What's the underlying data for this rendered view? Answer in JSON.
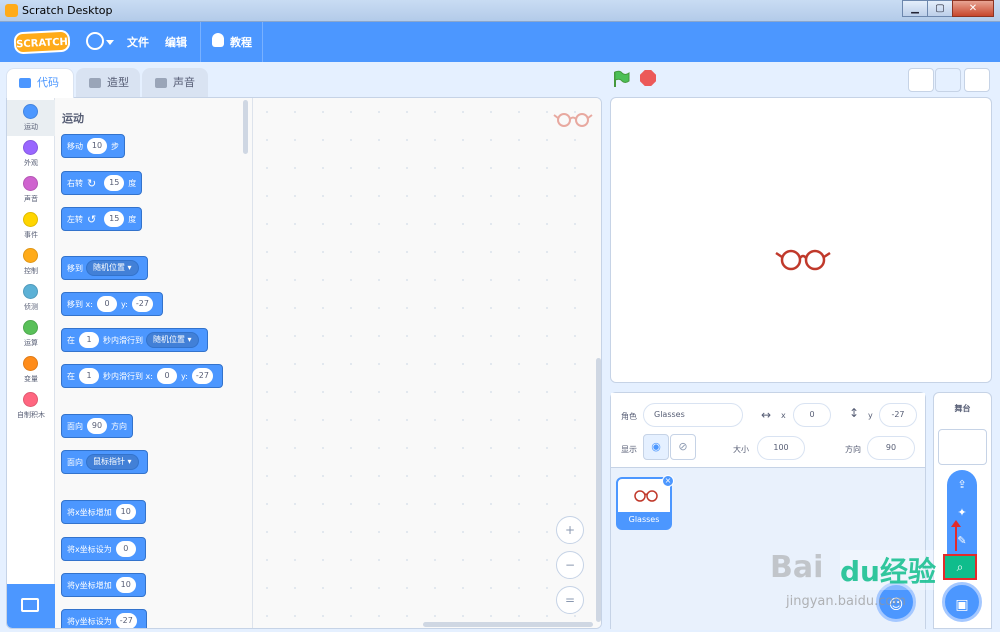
{
  "window": {
    "title": "Scratch Desktop"
  },
  "menubar": {
    "logo": "SCRATCH",
    "file": "文件",
    "edit": "编辑",
    "tutorials": "教程"
  },
  "tabs": [
    {
      "label": "代码"
    },
    {
      "label": "造型"
    },
    {
      "label": "声音"
    }
  ],
  "categories": [
    {
      "label": "运动",
      "color": "#4c97ff"
    },
    {
      "label": "外观",
      "color": "#9966ff"
    },
    {
      "label": "声音",
      "color": "#cf63cf"
    },
    {
      "label": "事件",
      "color": "#ffd500"
    },
    {
      "label": "控制",
      "color": "#ffab19"
    },
    {
      "label": "侦测",
      "color": "#5cb1d6"
    },
    {
      "label": "运算",
      "color": "#59c059"
    },
    {
      "label": "变量",
      "color": "#ff8c1a"
    },
    {
      "label": "自制积木",
      "color": "#ff6680"
    }
  ],
  "palette": {
    "title": "运动",
    "blocks": {
      "move": {
        "a": "移动",
        "v": "10",
        "b": "步"
      },
      "turn_right": {
        "a": "右转",
        "icon": "↻",
        "v": "15",
        "b": "度"
      },
      "turn_left": {
        "a": "左转",
        "icon": "↺",
        "v": "15",
        "b": "度"
      },
      "goto": {
        "a": "移到",
        "d": "随机位置"
      },
      "goto_xy": {
        "a": "移到 x:",
        "x": "0",
        "ylbl": "y:",
        "y": "-27"
      },
      "glide": {
        "a": "在",
        "v": "1",
        "b": "秒内滑行到",
        "d": "随机位置"
      },
      "glide_xy": {
        "a": "在",
        "v": "1",
        "b": "秒内滑行到 x:",
        "x": "0",
        "ylbl": "y:",
        "y": "-27"
      },
      "point_dir": {
        "a": "面向",
        "v": "90",
        "b": "方向"
      },
      "point_towards": {
        "a": "面向",
        "d": "鼠标指针"
      },
      "change_x": {
        "a": "将x坐标增加",
        "v": "10"
      },
      "set_x": {
        "a": "将x坐标设为",
        "v": "0"
      },
      "change_y": {
        "a": "将y坐标增加",
        "v": "10"
      },
      "set_y": {
        "a": "将y坐标设为",
        "v": "-27"
      }
    }
  },
  "zoom": {
    "in": "+",
    "out": "−",
    "reset": "="
  },
  "sprite": {
    "label_sprite": "角色",
    "name": "Glasses",
    "x_label": "x",
    "x": "0",
    "y_label": "y",
    "y": "-27",
    "show_label": "显示",
    "size_label": "大小",
    "size": "100",
    "direction_label": "方向",
    "direction": "90"
  },
  "sprites": [
    {
      "name": "Glasses"
    }
  ],
  "stage_pane": {
    "title": "舞台"
  },
  "watermark": {
    "a": "Bai",
    "b": "du经验",
    "c": "jingyan.baidu.com"
  }
}
